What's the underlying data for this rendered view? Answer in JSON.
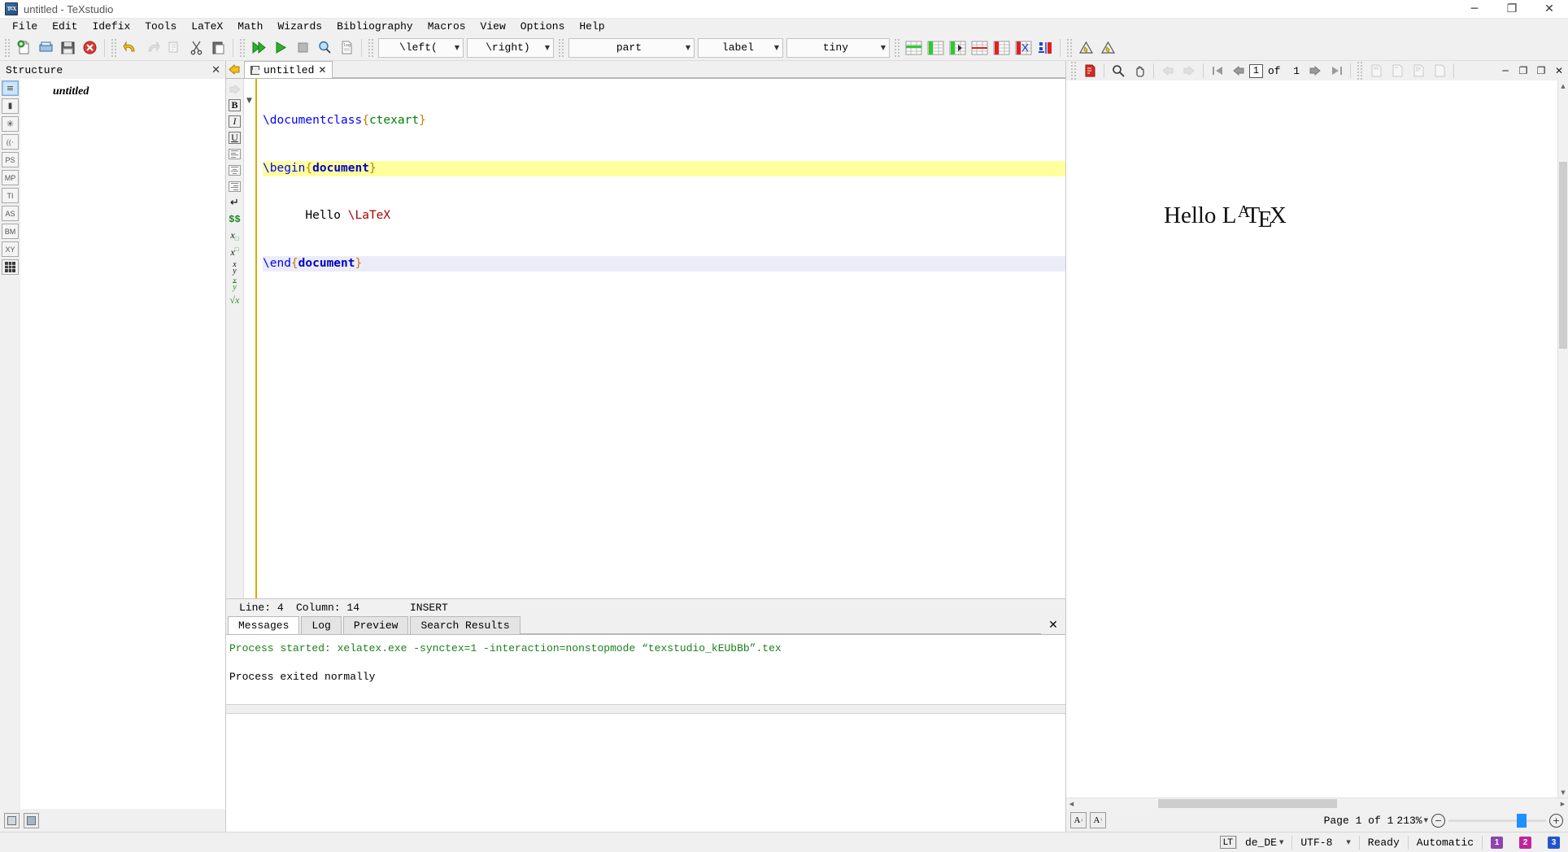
{
  "window": {
    "title": "untitled - TeXstudio",
    "app_icon": "texstudio-icon",
    "minimize": "─",
    "maximize": "❐",
    "close": "✕"
  },
  "menubar": {
    "items": [
      {
        "label": "File"
      },
      {
        "label": "Edit"
      },
      {
        "label": "Idefix"
      },
      {
        "label": "Tools"
      },
      {
        "label": "LaTeX"
      },
      {
        "label": "Math"
      },
      {
        "label": "Wizards"
      },
      {
        "label": "Bibliography"
      },
      {
        "label": "Macros"
      },
      {
        "label": "View"
      },
      {
        "label": "Options"
      },
      {
        "label": "Help"
      }
    ]
  },
  "toolbar": {
    "buttons": [
      {
        "name": "new-document",
        "title": "New"
      },
      {
        "name": "open-document",
        "title": "Open"
      },
      {
        "name": "save-document",
        "title": "Save"
      },
      {
        "name": "close-document",
        "title": "Close"
      },
      {
        "name": "undo",
        "title": "Undo"
      },
      {
        "name": "redo",
        "title": "Redo"
      },
      {
        "name": "copy",
        "title": "Copy"
      },
      {
        "name": "cut",
        "title": "Cut"
      },
      {
        "name": "paste",
        "title": "Paste"
      },
      {
        "name": "build-and-view",
        "title": "Build & View"
      },
      {
        "name": "compile",
        "title": "Compile"
      },
      {
        "name": "stop-compile",
        "title": "Stop"
      },
      {
        "name": "view-log-search",
        "title": "View Log"
      },
      {
        "name": "log-file",
        "title": "Log File"
      }
    ],
    "combos": [
      {
        "name": "left-delimiter-combo",
        "value": "\\left("
      },
      {
        "name": "right-delimiter-combo",
        "value": "\\right)"
      },
      {
        "name": "section-combo",
        "value": "part"
      },
      {
        "name": "label-combo",
        "value": "label"
      },
      {
        "name": "fontsize-combo",
        "value": "tiny"
      }
    ],
    "table_buttons": [
      {
        "name": "insert-row-above-icon"
      },
      {
        "name": "insert-column-left-icon"
      },
      {
        "name": "insert-column-icon"
      },
      {
        "name": "remove-row-icon"
      },
      {
        "name": "remove-column-icon"
      },
      {
        "name": "cut-column-icon"
      },
      {
        "name": "paste-column-icon"
      }
    ],
    "warning_buttons": [
      {
        "name": "warning-icon-1"
      },
      {
        "name": "warning-icon-2"
      }
    ]
  },
  "structure": {
    "title": "Structure",
    "close": "✕",
    "icons": [
      {
        "name": "structure-view-icon",
        "glyph": "≡",
        "selected": true
      },
      {
        "name": "bookmarks-icon",
        "glyph": "▮",
        "selected": false
      },
      {
        "name": "symbols-icon",
        "glyph": "✱",
        "selected": false
      },
      {
        "name": "brackets-icon",
        "glyph": "((·",
        "selected": false
      },
      {
        "name": "ps-symbols-icon",
        "glyph": "PS",
        "selected": false
      },
      {
        "name": "mp-symbols-icon",
        "glyph": "MP",
        "selected": false
      },
      {
        "name": "ti-symbols-icon",
        "glyph": "TI",
        "selected": false
      },
      {
        "name": "as-symbols-icon",
        "glyph": "AS",
        "selected": false
      },
      {
        "name": "bm-symbols-icon",
        "glyph": "BM",
        "selected": false
      },
      {
        "name": "xy-symbols-icon",
        "glyph": "XY",
        "selected": false
      },
      {
        "name": "grid-icon",
        "glyph": "■",
        "selected": false
      }
    ],
    "tree": [
      {
        "label": "untitled"
      }
    ],
    "footer": [
      {
        "name": "panel-toggle-left"
      },
      {
        "name": "panel-toggle-right"
      }
    ]
  },
  "editor": {
    "tab": {
      "label": "untitled",
      "close": "✕",
      "icon": "save-icon"
    },
    "nav_back": "◀",
    "nav_forward": "▶",
    "format_tools": [
      {
        "name": "bold-button",
        "glyph": "B"
      },
      {
        "name": "italic-button",
        "glyph": "I"
      },
      {
        "name": "underline-button",
        "glyph": "U"
      },
      {
        "name": "align-left-button"
      },
      {
        "name": "align-center-button"
      },
      {
        "name": "align-right-button"
      },
      {
        "name": "newline-button",
        "glyph": "↵"
      },
      {
        "name": "math-mode-button",
        "glyph": "$$"
      },
      {
        "name": "subscript-button",
        "glyph": "x□"
      },
      {
        "name": "superscript-button",
        "glyph": "x□"
      },
      {
        "name": "fraction-button",
        "glyph": "x/y"
      },
      {
        "name": "dfrac-button",
        "glyph": "x/y"
      },
      {
        "name": "sqrt-button",
        "glyph": "√x"
      }
    ],
    "lines": [
      {
        "n": 1,
        "state": "normal",
        "tokens": [
          {
            "t": "\\documentclass",
            "c": "cmd"
          },
          {
            "t": "{",
            "c": "br"
          },
          {
            "t": "ctexart",
            "c": "arg"
          },
          {
            "t": "}",
            "c": "br"
          }
        ]
      },
      {
        "n": 2,
        "state": "highlight",
        "tokens": [
          {
            "t": "\\begin",
            "c": "cmd"
          },
          {
            "t": "{",
            "c": "br"
          },
          {
            "t": "document",
            "c": "argb"
          },
          {
            "t": "}",
            "c": "br"
          }
        ]
      },
      {
        "n": 3,
        "state": "normal",
        "tokens": [
          {
            "t": "      Hello ",
            "c": "txt"
          },
          {
            "t": "\\LaTeX",
            "c": "ltx"
          }
        ]
      },
      {
        "n": 4,
        "state": "current",
        "tokens": [
          {
            "t": "\\end",
            "c": "cmd"
          },
          {
            "t": "{",
            "c": "br"
          },
          {
            "t": "document",
            "c": "argb"
          },
          {
            "t": "}",
            "c": "br"
          }
        ]
      }
    ],
    "status": {
      "line_label": "Line:",
      "line_value": "4",
      "column_label": "Column:",
      "column_value": "14",
      "mode": "INSERT"
    }
  },
  "messages": {
    "tabs": [
      {
        "label": "Messages",
        "active": true
      },
      {
        "label": "Log",
        "active": false
      },
      {
        "label": "Preview",
        "active": false
      },
      {
        "label": "Search Results",
        "active": false
      }
    ],
    "close": "✕",
    "output_started": "Process started: xelatex.exe -synctex=1 -interaction=nonstopmode “texstudio_kEUbBb”.tex",
    "output_exited": "Process exited normally"
  },
  "pdf": {
    "toolbar": {
      "pdf_icon": "pdf-file-icon",
      "magnify": "magnifier-icon",
      "hand": "hand-tool-icon",
      "back": "◀",
      "forward": "▶",
      "first_page": "⏮",
      "prev_page": "◀",
      "page_value": "1",
      "of_label": "of",
      "page_total": "1",
      "next_page": "▶",
      "last_page": "⏭",
      "fit_width": "fit-width-icon",
      "fit_page": "fit-page-icon",
      "fit_text": "fit-text-icon",
      "single_page": "single-page-icon",
      "win_minimize": "─",
      "win_restore": "❐",
      "win_float": "❐",
      "win_close": "✕"
    },
    "page_content": {
      "hello": "Hello",
      "logo": "LaTeX"
    },
    "status": {
      "sync_fwd": "sync-forward-icon",
      "sync_back": "sync-backward-icon",
      "page_label": "Page 1 of 1",
      "zoom": "213%",
      "zoom_out": "⊖",
      "zoom_in": "⊕"
    }
  },
  "statusbar": {
    "lt_badge": "LT",
    "language": "de_DE",
    "encoding": "UTF-8",
    "state": "Ready",
    "mode": "Automatic",
    "badges": [
      {
        "label": "1",
        "cls": "b1"
      },
      {
        "label": "2",
        "cls": "b2"
      },
      {
        "label": "3",
        "cls": "b3"
      }
    ]
  },
  "colors": {
    "accent": "#1e90ff",
    "highlight": "#ffff9e",
    "current_line": "#ececf8",
    "command": "#0000ff",
    "brace": "#c08000",
    "argument": "#008000",
    "latex_cmd": "#b00000",
    "success": "#1a7f1a",
    "chrome": "#f0f0f0"
  }
}
